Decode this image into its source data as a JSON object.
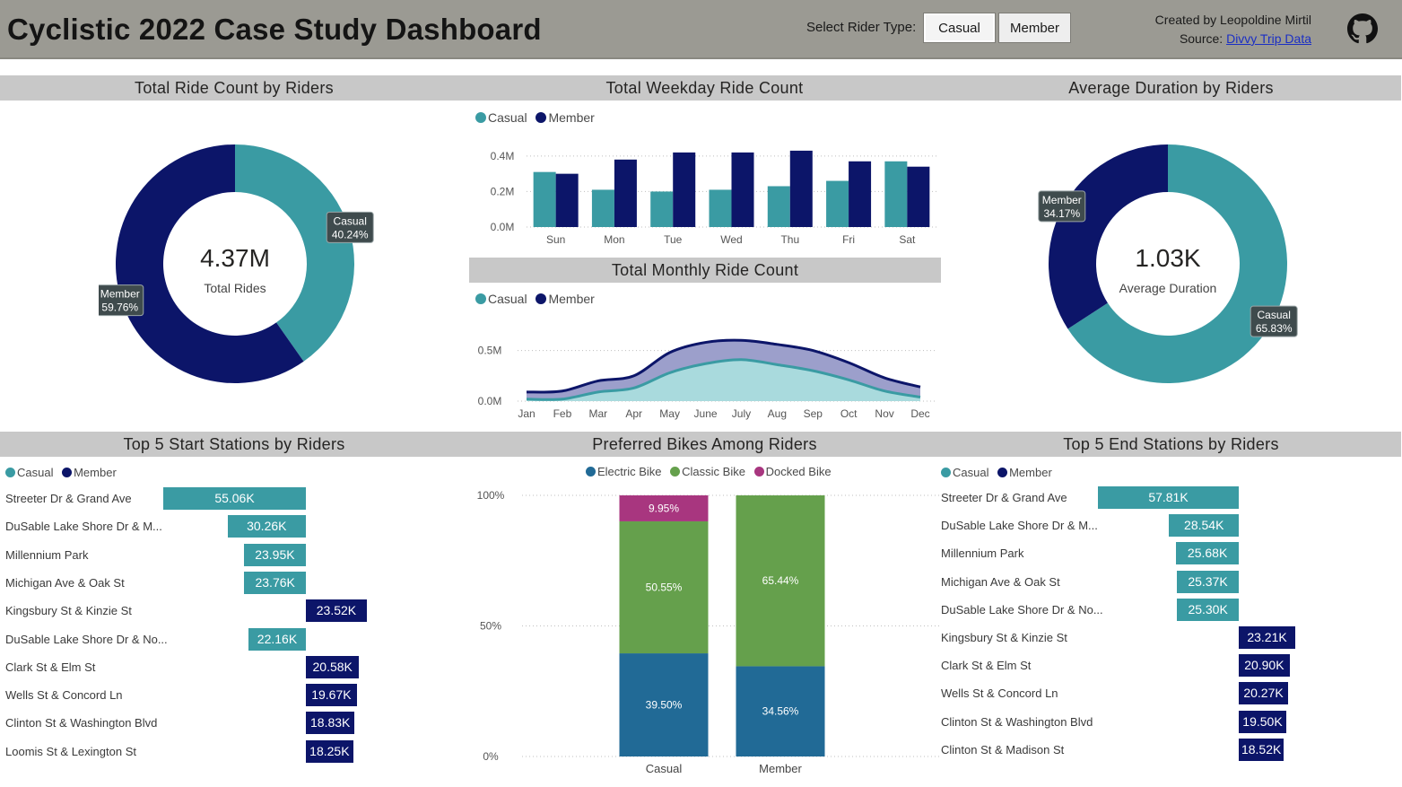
{
  "header": {
    "title": "Cyclistic 2022 Case Study Dashboard",
    "rider_label": "Select Rider Type:",
    "casual_btn": "Casual",
    "member_btn": "Member",
    "created_by": "Created by Leopoldine Mirtil",
    "source_label": "Source:",
    "source_link": "Divvy Trip Data",
    "github_icon": "github-icon"
  },
  "colors": {
    "casual": "#3a9ba3",
    "member": "#0c1569",
    "header_bg": "#9b9a93",
    "section_bg": "#c8c8c8",
    "electric": "#216a96",
    "classic": "#65a04c",
    "docked": "#a8367f"
  },
  "sections": {
    "total_ride": "Total Ride Count by Riders",
    "weekday": "Total Weekday Ride Count",
    "monthly": "Total Monthly Ride Count",
    "avg_duration": "Average Duration by Riders",
    "start_stations": "Top 5 Start Stations by Riders",
    "bikes": "Preferred Bikes Among Riders",
    "end_stations": "Top 5 End Stations by Riders"
  },
  "legends": {
    "casual": "Casual",
    "member": "Member",
    "electric": "Electric Bike",
    "classic": "Classic Bike",
    "docked": "Docked Bike"
  },
  "chart_data": [
    {
      "id": "total_ride",
      "type": "pie",
      "center_value": "4.37M",
      "center_label": "Total Rides",
      "slices": [
        {
          "name": "Casual",
          "percent": 40.24,
          "label": "Casual",
          "value_label": "40.24%"
        },
        {
          "name": "Member",
          "percent": 59.76,
          "label": "Member",
          "value_label": "59.76%"
        }
      ]
    },
    {
      "id": "weekday",
      "type": "bar",
      "categories": [
        "Sun",
        "Mon",
        "Tue",
        "Wed",
        "Thu",
        "Fri",
        "Sat"
      ],
      "series": [
        {
          "name": "Casual",
          "values": [
            0.31,
            0.21,
            0.2,
            0.21,
            0.23,
            0.26,
            0.37
          ]
        },
        {
          "name": "Member",
          "values": [
            0.3,
            0.38,
            0.42,
            0.42,
            0.43,
            0.37,
            0.34
          ]
        }
      ],
      "yticks": [
        "0.0M",
        "0.2M",
        "0.4M"
      ],
      "ylim": [
        0,
        0.47
      ]
    },
    {
      "id": "monthly",
      "type": "area",
      "categories": [
        "Jan",
        "Feb",
        "Mar",
        "Apr",
        "May",
        "June",
        "July",
        "Aug",
        "Sep",
        "Oct",
        "Nov",
        "Dec"
      ],
      "series": [
        {
          "name": "Casual",
          "values": [
            0.02,
            0.02,
            0.09,
            0.13,
            0.28,
            0.37,
            0.41,
            0.36,
            0.3,
            0.21,
            0.1,
            0.04
          ]
        },
        {
          "name": "Member",
          "values": [
            0.09,
            0.1,
            0.2,
            0.25,
            0.48,
            0.58,
            0.6,
            0.56,
            0.5,
            0.38,
            0.23,
            0.14
          ]
        }
      ],
      "yticks": [
        "0.0M",
        "0.5M"
      ],
      "ylim": [
        0,
        0.7
      ]
    },
    {
      "id": "avg_duration",
      "type": "pie",
      "center_value": "1.03K",
      "center_label": "Average Duration",
      "slices": [
        {
          "name": "Casual",
          "percent": 65.83,
          "label": "Casual",
          "value_label": "65.83%"
        },
        {
          "name": "Member",
          "percent": 34.17,
          "label": "Member",
          "value_label": "34.17%"
        }
      ]
    },
    {
      "id": "start_stations",
      "type": "bar",
      "orientation": "horizontal-diverging",
      "max_value": 55.06,
      "rows": [
        {
          "station": "Streeter Dr & Grand Ave",
          "rider": "Casual",
          "value": 55.06,
          "label": "55.06K"
        },
        {
          "station": "DuSable Lake Shore Dr & M...",
          "rider": "Casual",
          "value": 30.26,
          "label": "30.26K"
        },
        {
          "station": "Millennium Park",
          "rider": "Casual",
          "value": 23.95,
          "label": "23.95K"
        },
        {
          "station": "Michigan Ave & Oak St",
          "rider": "Casual",
          "value": 23.76,
          "label": "23.76K"
        },
        {
          "station": "Kingsbury St & Kinzie St",
          "rider": "Member",
          "value": 23.52,
          "label": "23.52K"
        },
        {
          "station": "DuSable Lake Shore Dr & No...",
          "rider": "Casual",
          "value": 22.16,
          "label": "22.16K"
        },
        {
          "station": "Clark St & Elm St",
          "rider": "Member",
          "value": 20.58,
          "label": "20.58K"
        },
        {
          "station": "Wells St & Concord Ln",
          "rider": "Member",
          "value": 19.67,
          "label": "19.67K"
        },
        {
          "station": "Clinton St & Washington Blvd",
          "rider": "Member",
          "value": 18.83,
          "label": "18.83K"
        },
        {
          "station": "Loomis St & Lexington St",
          "rider": "Member",
          "value": 18.25,
          "label": "18.25K"
        }
      ]
    },
    {
      "id": "bikes",
      "type": "bar",
      "orientation": "stacked-100",
      "categories": [
        "Casual",
        "Member"
      ],
      "series": [
        {
          "name": "Electric Bike",
          "values": [
            39.5,
            34.56
          ],
          "labels": [
            "39.50%",
            "34.56%"
          ]
        },
        {
          "name": "Classic Bike",
          "values": [
            50.55,
            65.44
          ],
          "labels": [
            "50.55%",
            "65.44%"
          ]
        },
        {
          "name": "Docked Bike",
          "values": [
            9.95,
            0
          ],
          "labels": [
            "9.95%",
            ""
          ]
        }
      ],
      "yticks": [
        "0%",
        "50%",
        "100%"
      ]
    },
    {
      "id": "end_stations",
      "type": "bar",
      "orientation": "horizontal-diverging",
      "max_value": 57.81,
      "rows": [
        {
          "station": "Streeter Dr & Grand Ave",
          "rider": "Casual",
          "value": 57.81,
          "label": "57.81K"
        },
        {
          "station": "DuSable Lake Shore Dr & M...",
          "rider": "Casual",
          "value": 28.54,
          "label": "28.54K"
        },
        {
          "station": "Millennium Park",
          "rider": "Casual",
          "value": 25.68,
          "label": "25.68K"
        },
        {
          "station": "Michigan Ave & Oak St",
          "rider": "Casual",
          "value": 25.37,
          "label": "25.37K"
        },
        {
          "station": "DuSable Lake Shore Dr & No...",
          "rider": "Casual",
          "value": 25.3,
          "label": "25.30K"
        },
        {
          "station": "Kingsbury St & Kinzie St",
          "rider": "Member",
          "value": 23.21,
          "label": "23.21K"
        },
        {
          "station": "Clark St & Elm St",
          "rider": "Member",
          "value": 20.9,
          "label": "20.90K"
        },
        {
          "station": "Wells St & Concord Ln",
          "rider": "Member",
          "value": 20.27,
          "label": "20.27K"
        },
        {
          "station": "Clinton St & Washington Blvd",
          "rider": "Member",
          "value": 19.5,
          "label": "19.50K"
        },
        {
          "station": "Clinton St & Madison St",
          "rider": "Member",
          "value": 18.52,
          "label": "18.52K"
        }
      ]
    }
  ]
}
